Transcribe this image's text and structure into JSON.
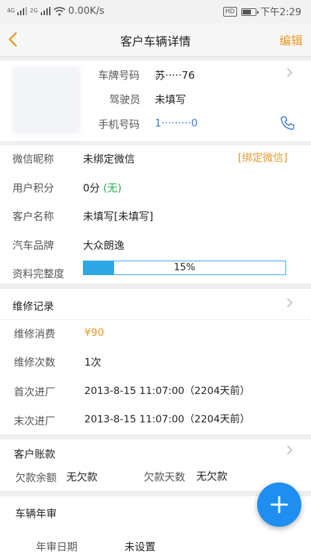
{
  "status_bar": {
    "network_speed": "0.00K/s",
    "signal1": "4G",
    "signal2": "2G",
    "hd": "HD",
    "time": "下午2:29"
  },
  "header": {
    "title": "客户车辆详情",
    "edit_label": "编辑"
  },
  "vehicle": {
    "plate_label": "车牌号码",
    "plate_value": "苏·····76",
    "driver_label": "驾驶员",
    "driver_value": "未填写",
    "phone_label": "手机号码",
    "phone_value": "1·········0"
  },
  "customer": {
    "wechat_label": "微信昵称",
    "wechat_value": "未绑定微信",
    "bind_wechat": "[绑定微信]",
    "points_label": "用户积分",
    "points_value": "0分",
    "points_note": "(无)",
    "name_label": "客户名称",
    "name_value": "未填写[未填写]",
    "brand_label": "汽车品牌",
    "brand_value": "大众朗逸",
    "completeness_label": "资料完整度",
    "completeness_text": "15%",
    "completeness_fraction": 0.15
  },
  "repair": {
    "section_title": "维修记录",
    "spend_label": "维修消费",
    "spend_value": "¥90",
    "count_label": "维修次数",
    "count_value": "1次",
    "first_label": "首次进厂",
    "first_value": "2013-8-15 11:07:00（2204天前）",
    "last_label": "末次进厂",
    "last_value": "2013-8-15 11:07:00（2204天前）"
  },
  "account": {
    "section_title": "客户账款",
    "balance_label": "欠款余额",
    "balance_value": "无欠款",
    "days_label": "欠款天数",
    "days_value": "无欠款"
  },
  "inspection": {
    "section_title": "车辆年审",
    "date_label": "年审日期",
    "date_value": "未设置"
  },
  "colors": {
    "accent_orange": "#e89a2a",
    "link_blue": "#3a7bd5",
    "progress_blue": "#2ea8e5",
    "fab_blue": "#1e8ff0",
    "green": "#2fa84f"
  }
}
